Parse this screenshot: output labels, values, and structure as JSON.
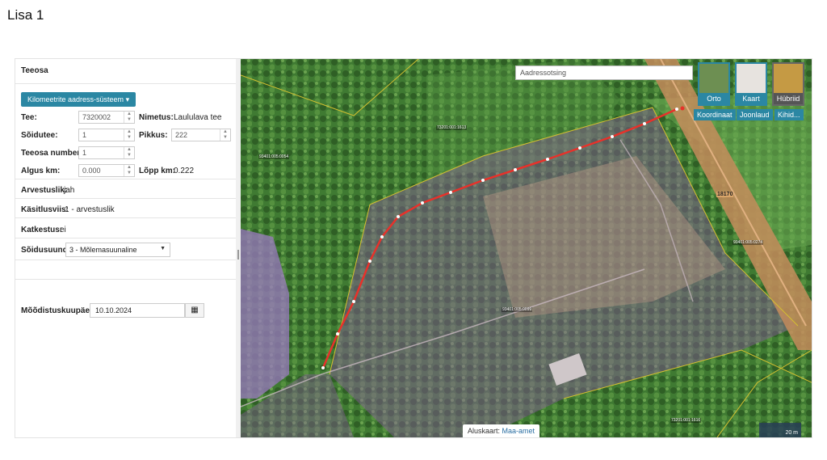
{
  "page": {
    "title": "Lisa 1"
  },
  "panel": {
    "header": "Teeosa",
    "km_button": "Kilomeetrite aadress-süsteem",
    "tee": {
      "label": "Tee:",
      "value": "7320002"
    },
    "nimetus": {
      "label": "Nimetus:",
      "value": "Laululava tee"
    },
    "soidutee": {
      "label": "Sõidutee:",
      "value": "1"
    },
    "pikkus": {
      "label": "Pikkus:",
      "value": "222"
    },
    "teeosa_number": {
      "label": "Teeosa number:",
      "value": "1"
    },
    "algus": {
      "label": "Algus km:",
      "value": "0.000"
    },
    "lopp": {
      "label": "Lõpp km:",
      "value": "0.222"
    },
    "arvestuslik": {
      "label": "Arvestuslik:",
      "value": "jah"
    },
    "kasitlusviis": {
      "label": "Käsitlusviis:",
      "value": "1 - arvestuslik"
    },
    "katkestus": {
      "label": "Katkestus:",
      "value": "ei"
    },
    "soidusuund": {
      "label": "Sõidusuund:",
      "value": "3 - Mõlemasuunaline"
    },
    "mooditus": {
      "label": "Mõõdistuskuupäev:",
      "value": "10.10.2024"
    }
  },
  "map": {
    "search_placeholder": "Aadressotsing",
    "layers": [
      "Orto",
      "Kaart",
      "Hübriid"
    ],
    "active_layer": "Hübriid",
    "tools": [
      "Koordinaat",
      "Joonlaud",
      "Kihid..."
    ],
    "parcel_labels": [
      "93401:005:0054",
      "73201:001:1613",
      "93401:005:0274",
      "93401:005:0099",
      "73201:001:1616"
    ],
    "road_number": "18170",
    "attribution_prefix": "Aluskaart:",
    "attribution_link": "Maa-amet",
    "scale_text": "20 m",
    "colors": {
      "accent": "#2b87a3",
      "route": "#e8312a"
    }
  }
}
